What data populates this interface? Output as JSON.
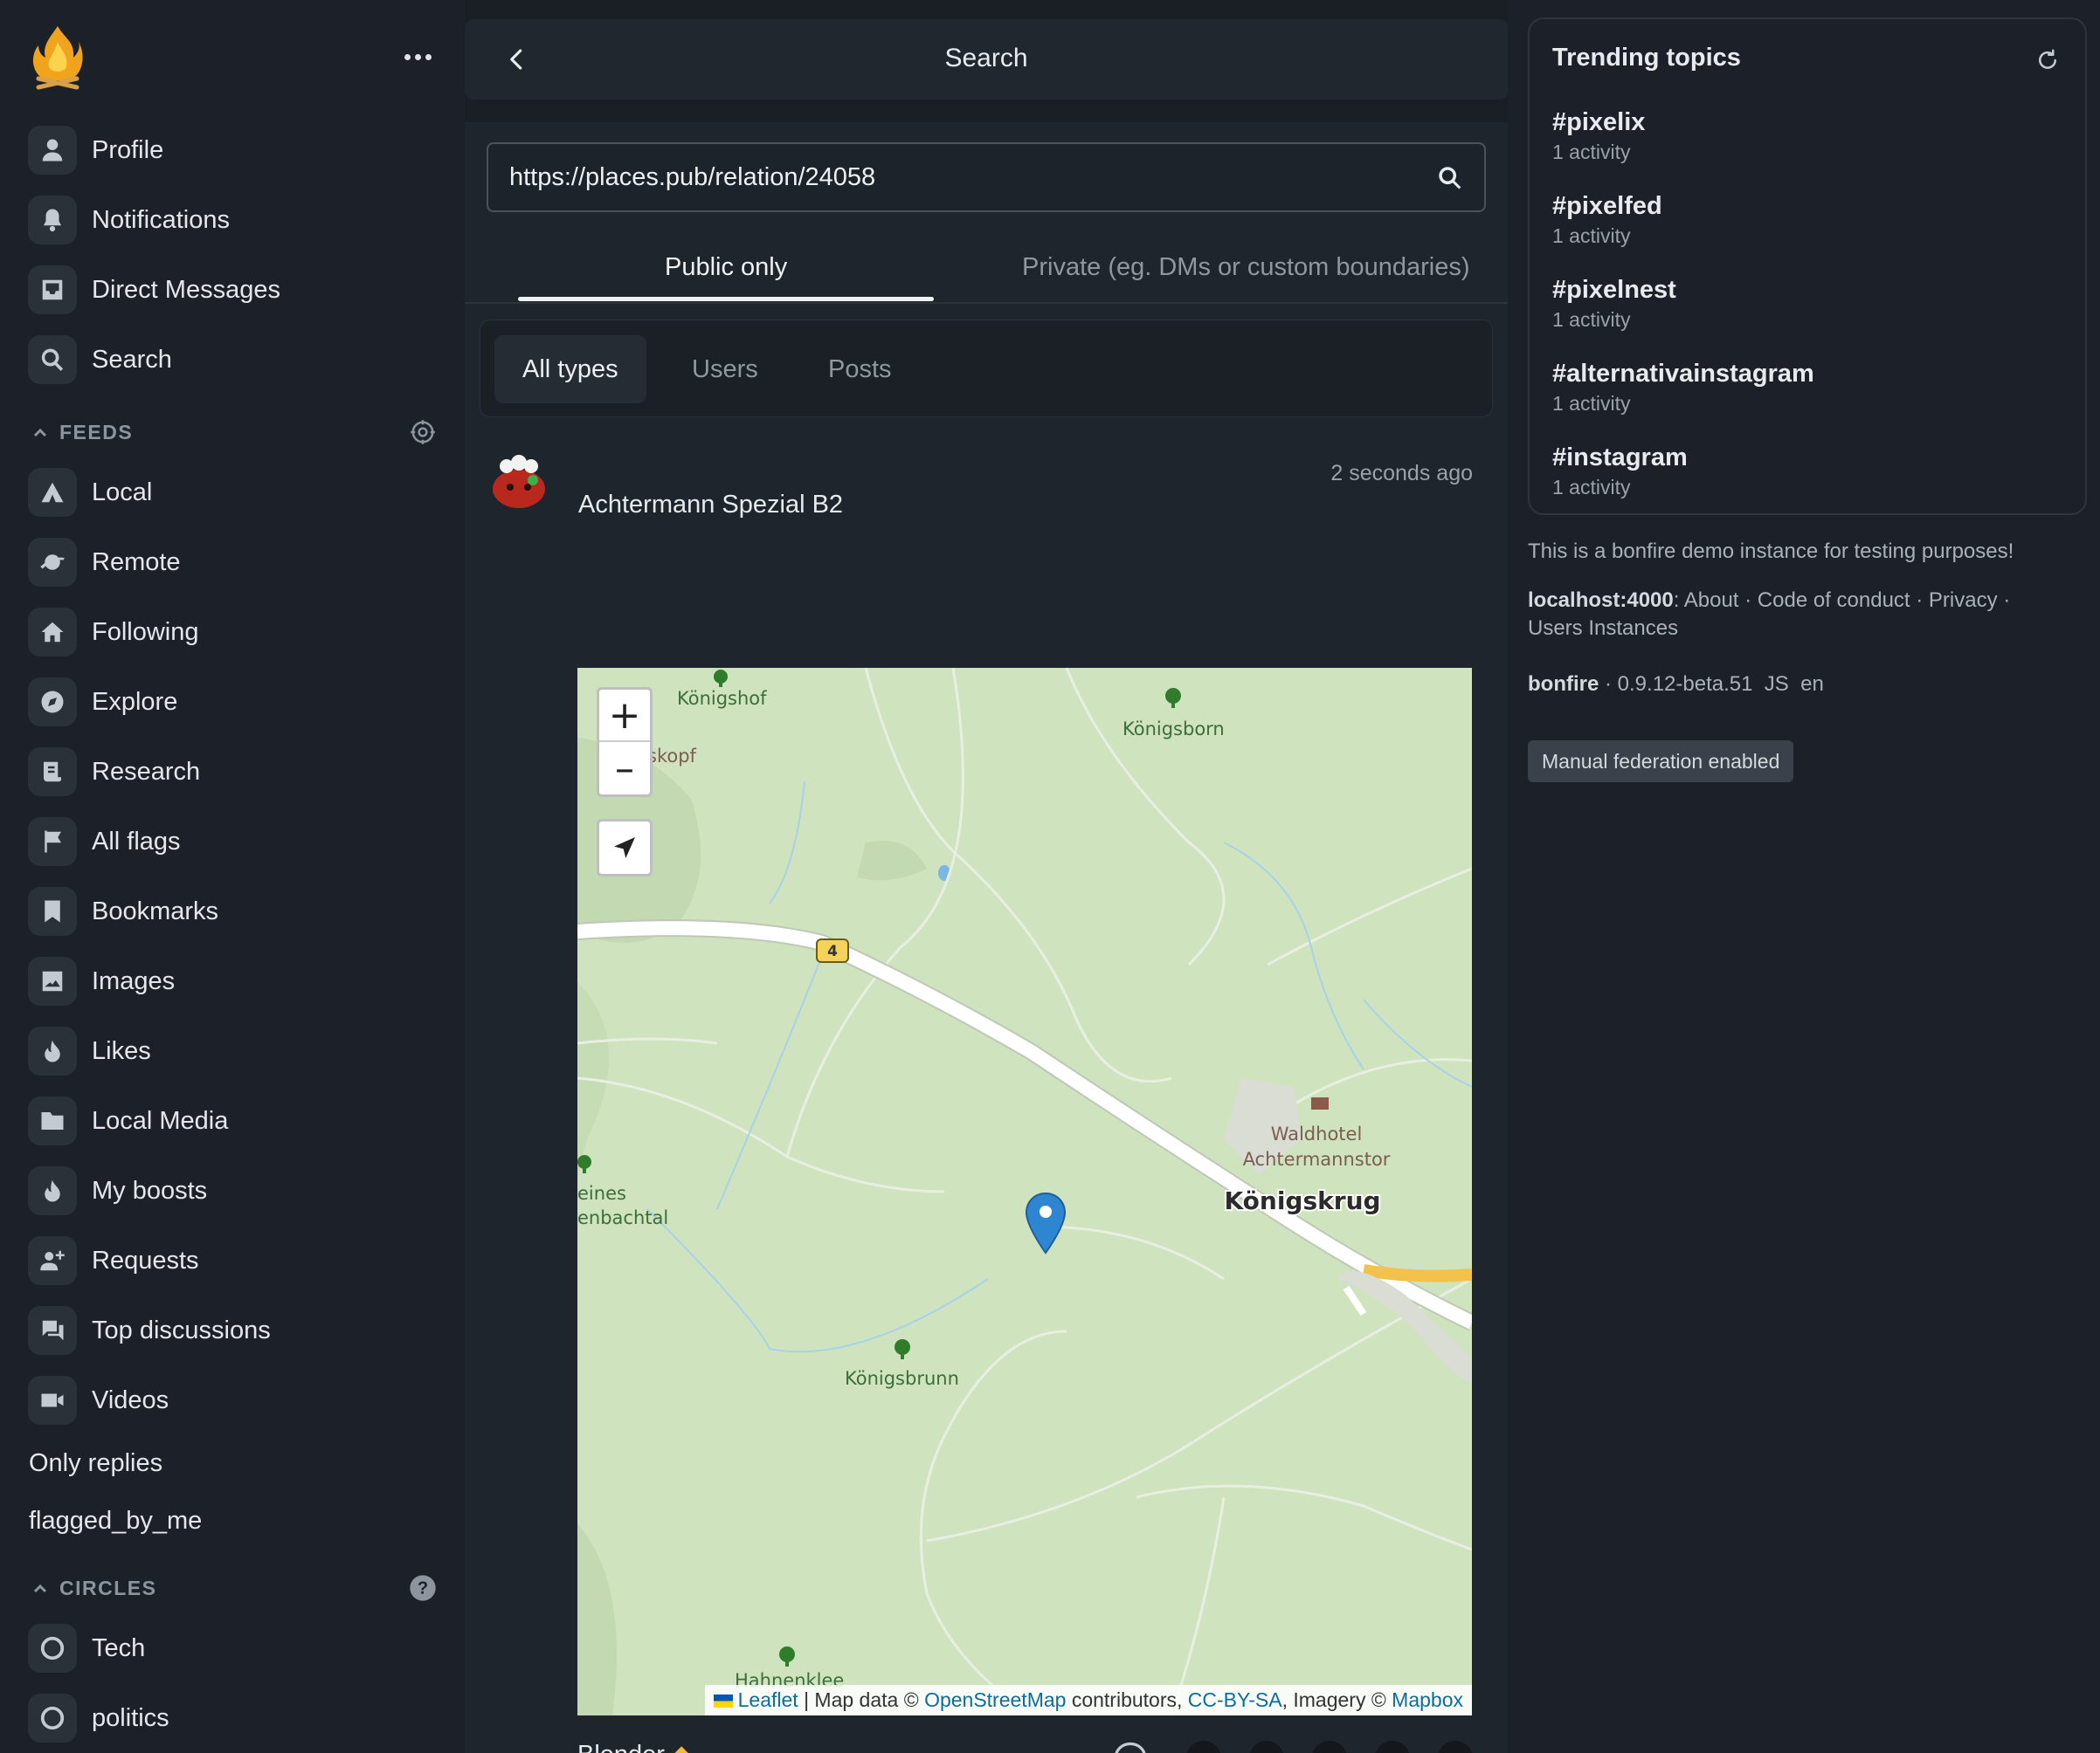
{
  "sidebar": {
    "main_items": [
      {
        "label": "Profile",
        "icon": "user-icon"
      },
      {
        "label": "Notifications",
        "icon": "bell-icon"
      },
      {
        "label": "Direct Messages",
        "icon": "inbox-icon"
      },
      {
        "label": "Search",
        "icon": "search-icon"
      }
    ],
    "feeds_heading": "FEEDS",
    "feeds": [
      {
        "label": "Local",
        "icon": "tent-icon"
      },
      {
        "label": "Remote",
        "icon": "planet-icon"
      },
      {
        "label": "Following",
        "icon": "home-icon"
      },
      {
        "label": "Explore",
        "icon": "compass-icon"
      },
      {
        "label": "Research",
        "icon": "scroll-icon"
      },
      {
        "label": "All flags",
        "icon": "flag-icon"
      },
      {
        "label": "Bookmarks",
        "icon": "bookmark-icon"
      },
      {
        "label": "Images",
        "icon": "image-icon"
      },
      {
        "label": "Likes",
        "icon": "flame-icon"
      },
      {
        "label": "Local Media",
        "icon": "folder-icon"
      },
      {
        "label": "My boosts",
        "icon": "flame-icon"
      },
      {
        "label": "Requests",
        "icon": "user-plus-icon"
      },
      {
        "label": "Top discussions",
        "icon": "chat-icon"
      },
      {
        "label": "Videos",
        "icon": "video-icon"
      }
    ],
    "extra_feeds": [
      "Only replies",
      "flagged_by_me"
    ],
    "circles_heading": "CIRCLES",
    "circles": [
      {
        "label": "Tech",
        "icon": "circle-icon"
      },
      {
        "label": "politics",
        "icon": "circle-icon"
      }
    ]
  },
  "header": {
    "title": "Search"
  },
  "search": {
    "value": "https://places.pub/relation/24058"
  },
  "boundary_tabs": [
    "Public only",
    "Private (eg. DMs or custom boundaries)"
  ],
  "type_filters": [
    "All types",
    "Users",
    "Posts"
  ],
  "activity": {
    "timestamp": "2 seconds ago",
    "title": "Achtermann Spezial B2",
    "map": {
      "labels": {
        "konigshof": "Königshof",
        "skopf": "skopf",
        "konigsborn": "Königsborn",
        "road": "4",
        "waldhotel1": "Waldhotel",
        "waldhotel2": "Achtermannstor",
        "konigskrug": "Königskrug",
        "eines": "eines",
        "enbachtal": "enbachtal",
        "konigsbrunn": "Königsbrunn",
        "hahnenklee": "Hahnenklee"
      },
      "zoom_in": "+",
      "zoom_out": "–",
      "attribution": {
        "leaflet": "Leaflet",
        "map_data": "| Map data ©",
        "osm": "OpenStreetMap",
        "contributors": "contributors,",
        "license": "CC-BY-SA",
        "imagery": ", Imagery ©",
        "mapbox": "Mapbox"
      }
    }
  },
  "next_activity": {
    "title": "Blender"
  },
  "trending": {
    "title": "Trending topics",
    "items": [
      {
        "tag": "#pixelix",
        "count": "1 activity"
      },
      {
        "tag": "#pixelfed",
        "count": "1 activity"
      },
      {
        "tag": "#pixelnest",
        "count": "1 activity"
      },
      {
        "tag": "#alternativainstagram",
        "count": "1 activity"
      },
      {
        "tag": "#instagram",
        "count": "1 activity"
      }
    ]
  },
  "instance": {
    "description": "This is a bonfire demo instance for testing purposes!",
    "host": "localhost:4000",
    "links": [
      "About",
      "Code of conduct",
      "Privacy",
      "Users",
      "Instances"
    ],
    "app_name": "bonfire",
    "version": "0.9.12-beta.51",
    "js": "JS",
    "lang": "en",
    "federation_badge": "Manual federation enabled"
  },
  "colors": {
    "background": "#1c2129",
    "panel": "#1f252d",
    "map_green": "#cfe3bf",
    "pin_blue": "#2f86d0",
    "text": "#dfe3e8"
  }
}
